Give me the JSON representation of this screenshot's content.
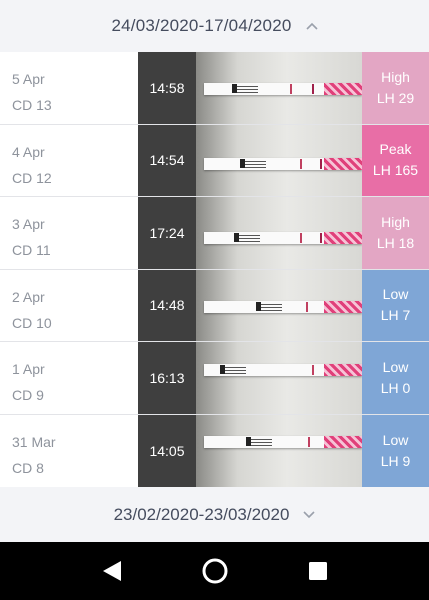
{
  "cycle_header": {
    "range": "24/03/2020-17/04/2020",
    "chevron_icon": "chevron-up-icon"
  },
  "tests": [
    {
      "date": "5 Apr",
      "cycle_day": "CD 13",
      "time": "14:58",
      "level": "High",
      "lh": "LH 29",
      "color": "#e3a6c4"
    },
    {
      "date": "4 Apr",
      "cycle_day": "CD 12",
      "time": "14:54",
      "level": "Peak",
      "lh": "LH 165",
      "color": "#e86ea6"
    },
    {
      "date": "3 Apr",
      "cycle_day": "CD 11",
      "time": "17:24",
      "level": "High",
      "lh": "LH 18",
      "color": "#e3a6c4"
    },
    {
      "date": "2 Apr",
      "cycle_day": "CD 10",
      "time": "14:48",
      "level": "Low",
      "lh": "LH 7",
      "color": "#7fa6d6"
    },
    {
      "date": "1 Apr",
      "cycle_day": "CD 9",
      "time": "16:13",
      "level": "Low",
      "lh": "LH 0",
      "color": "#7fa6d6"
    },
    {
      "date": "31 Mar",
      "cycle_day": "CD 8",
      "time": "14:05",
      "level": "Low",
      "lh": "LH 9",
      "color": "#7fa6d6"
    }
  ],
  "previous_cycle": {
    "range": "23/02/2020-23/03/2020",
    "chevron_icon": "chevron-down-icon"
  },
  "navbar": {
    "icons": [
      "back-icon",
      "home-icon",
      "recents-icon"
    ]
  }
}
